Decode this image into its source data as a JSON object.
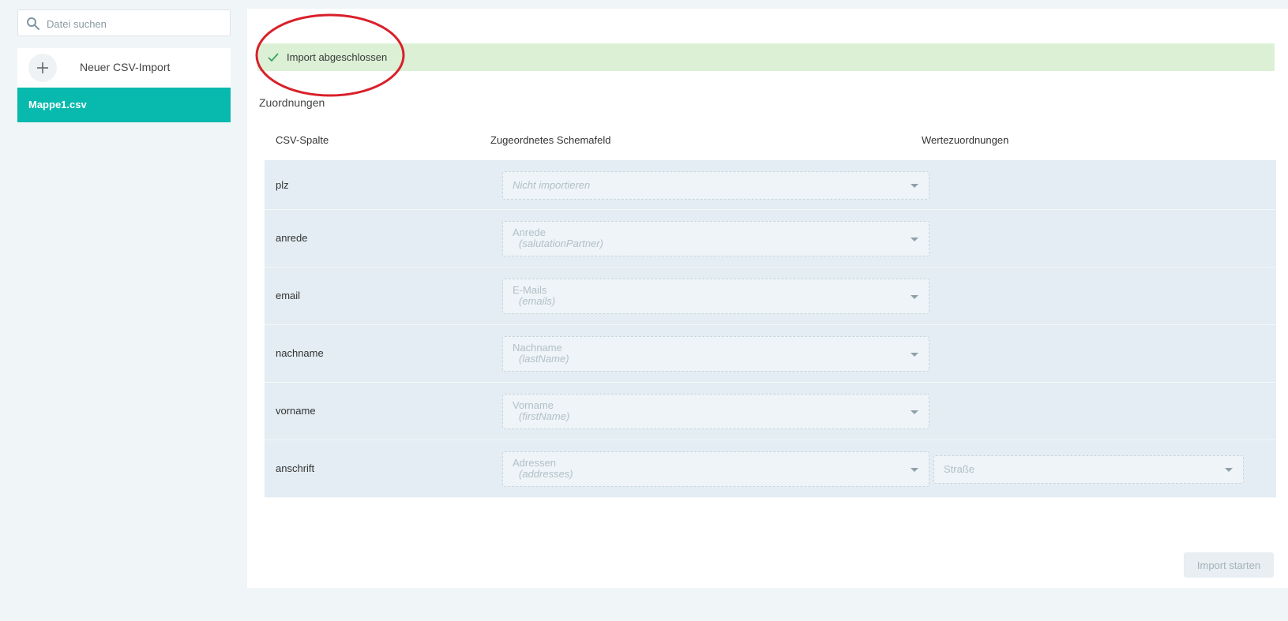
{
  "sidebar": {
    "search_placeholder": "Datei suchen",
    "new_import_label": "Neuer CSV-Import",
    "files": [
      "Mappe1.csv"
    ]
  },
  "main": {
    "status_message": "Import abgeschlossen",
    "section_title": "Zuordnungen",
    "columns": {
      "csv_column": "CSV-Spalte",
      "schema_field": "Zugeordnetes Schemafeld",
      "value_mappings": "Wertezuordnungen"
    },
    "rows": [
      {
        "csv": "plz",
        "field": "Nicht importieren",
        "field_key": ""
      },
      {
        "csv": "anrede",
        "field": "Anrede",
        "field_key": "(salutationPartner)"
      },
      {
        "csv": "email",
        "field": "E-Mails",
        "field_key": "(emails)"
      },
      {
        "csv": "nachname",
        "field": "Nachname",
        "field_key": "(lastName)"
      },
      {
        "csv": "vorname",
        "field": "Vorname",
        "field_key": "(firstName)"
      },
      {
        "csv": "anschrift",
        "field": "Adressen",
        "field_key": "(addresses)",
        "value_mapping": "Straße"
      }
    ],
    "start_button": "Import starten"
  },
  "colors": {
    "accent": "#08b9ad",
    "success_bg": "#dbf0d5",
    "annotation": "#d9202a"
  }
}
